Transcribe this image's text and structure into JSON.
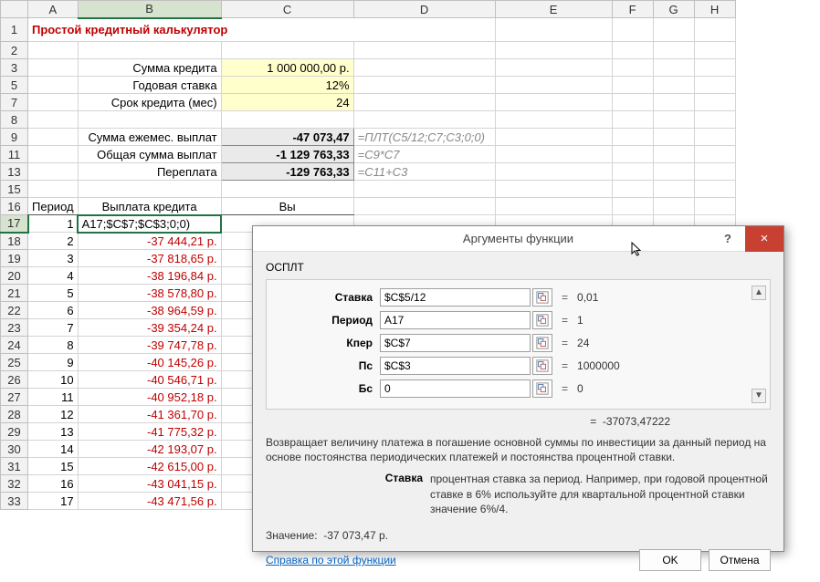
{
  "cols": [
    "A",
    "B",
    "C",
    "D",
    "E",
    "F",
    "G",
    "H"
  ],
  "rows": [
    1,
    2,
    3,
    5,
    7,
    8,
    9,
    11,
    13,
    15,
    16,
    17,
    18,
    19,
    20,
    21,
    22,
    23,
    24,
    25,
    26,
    27,
    28,
    29,
    30,
    31,
    32,
    33
  ],
  "title": "Простой кредитный калькулятор",
  "labels": {
    "loan_amount": "Сумма кредита",
    "rate": "Годовая ставка",
    "term": "Срок кредита (мес)",
    "payment": "Сумма ежемес. выплат",
    "total": "Общая сумма выплат",
    "over": "Переплата"
  },
  "inputs": {
    "loan_amount": "1 000 000,00 р.",
    "rate": "12%",
    "term": "24"
  },
  "calc": {
    "payment": "-47 073,47",
    "payment_formula": "=ПЛТ(C5/12;C7;C3;0;0)",
    "total": "-1 129 763,33",
    "total_formula": "=C9*C7",
    "over": "-129 763,33",
    "over_formula": "=C11+C3"
  },
  "table_headers": {
    "period": "Период",
    "pay": "Выплата кредита",
    "vy": "Вы"
  },
  "active_cell_text": "A17;$C$7;$C$3;0;0)",
  "payments": [
    {
      "n": 1
    },
    {
      "n": 2,
      "v": "-37 444,21 р."
    },
    {
      "n": 3,
      "v": "-37 818,65 р."
    },
    {
      "n": 4,
      "v": "-38 196,84 р."
    },
    {
      "n": 5,
      "v": "-38 578,80 р."
    },
    {
      "n": 6,
      "v": "-38 964,59 р."
    },
    {
      "n": 7,
      "v": "-39 354,24 р."
    },
    {
      "n": 8,
      "v": "-39 747,78 р."
    },
    {
      "n": 9,
      "v": "-40 145,26 р."
    },
    {
      "n": 10,
      "v": "-40 546,71 р."
    },
    {
      "n": 11,
      "v": "-40 952,18 р."
    },
    {
      "n": 12,
      "v": "-41 361,70 р."
    },
    {
      "n": 13,
      "v": "-41 775,32 р."
    },
    {
      "n": 14,
      "v": "-42 193,07 р."
    },
    {
      "n": 15,
      "v": "-42 615,00 р."
    },
    {
      "n": 16,
      "v": "-43 041,15 р."
    },
    {
      "n": 17,
      "v": "-43 471,56 р."
    }
  ],
  "dialog": {
    "title": "Аргументы функции",
    "fn": "ОСПЛТ",
    "args": [
      {
        "label": "Ставка",
        "input": "$C$5/12",
        "val": "0,01"
      },
      {
        "label": "Период",
        "input": "A17",
        "val": "1"
      },
      {
        "label": "Кпер",
        "input": "$C$7",
        "val": "24"
      },
      {
        "label": "Пс",
        "input": "$C$3",
        "val": "1000000"
      },
      {
        "label": "Бс",
        "input": "0",
        "val": "0"
      }
    ],
    "result_eq": "=",
    "result": "-37073,47222",
    "desc": "Возвращает величину платежа в погашение основной суммы по инвестиции за данный период на основе постоянства периодических платежей и постоянства процентной ставки.",
    "hint_label": "Ставка",
    "hint_text": "процентная ставка за период. Например, при годовой процентной ставке в 6% используйте для квартальной процентной ставки значение 6%/4.",
    "value_label": "Значение:",
    "value": "-37 073,47 р.",
    "help_link": "Справка по этой функции",
    "ok": "OK",
    "cancel": "Отмена"
  }
}
